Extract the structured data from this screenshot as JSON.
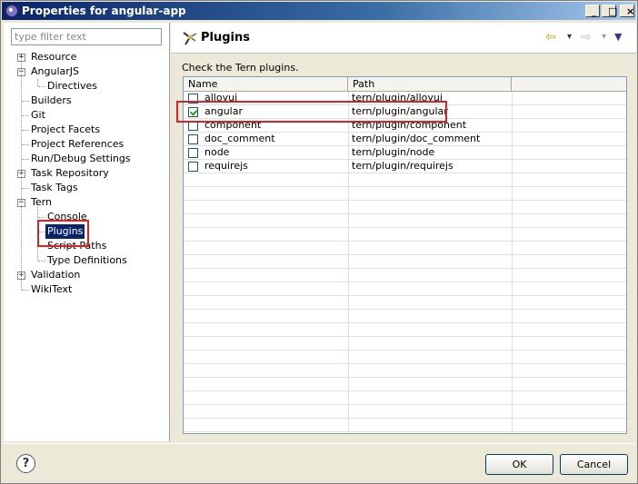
{
  "window": {
    "title": "Properties for angular-app"
  },
  "title_buttons": {
    "minimize": "_",
    "maximize": "□",
    "close": "×"
  },
  "filter": {
    "placeholder": "type filter text"
  },
  "tree": {
    "items": [
      {
        "label": "Resource",
        "level": 0,
        "expander": "+"
      },
      {
        "label": "AngularJS",
        "level": 0,
        "expander": "−"
      },
      {
        "label": "Directives",
        "level": 1
      },
      {
        "label": "Builders",
        "level": 0
      },
      {
        "label": "Git",
        "level": 0
      },
      {
        "label": "Project Facets",
        "level": 0
      },
      {
        "label": "Project References",
        "level": 0
      },
      {
        "label": "Run/Debug Settings",
        "level": 0
      },
      {
        "label": "Task Repository",
        "level": 0,
        "expander": "+"
      },
      {
        "label": "Task Tags",
        "level": 0
      },
      {
        "label": "Tern",
        "level": 0,
        "expander": "−"
      },
      {
        "label": "Console",
        "level": 1
      },
      {
        "label": "Plugins",
        "level": 1,
        "selected": true
      },
      {
        "label": "Script Paths",
        "level": 1
      },
      {
        "label": "Type Definitions",
        "level": 1
      },
      {
        "label": "Validation",
        "level": 0,
        "expander": "+"
      },
      {
        "label": "WikiText",
        "level": 0
      }
    ]
  },
  "page": {
    "title": "Plugins",
    "description": "Check the Tern plugins.",
    "nav": {
      "back": "⇦",
      "back_menu": "▾",
      "forward": "⇨",
      "forward_menu": "▾",
      "view_menu": "▼"
    }
  },
  "table": {
    "columns": [
      "Name",
      "Path"
    ],
    "rows": [
      {
        "name": "alloyui",
        "path": "tern/plugin/alloyui",
        "checked": false
      },
      {
        "name": "angular",
        "path": "tern/plugin/angular",
        "checked": true
      },
      {
        "name": "component",
        "path": "tern/plugin/component",
        "checked": false
      },
      {
        "name": "doc_comment",
        "path": "tern/plugin/doc_comment",
        "checked": false
      },
      {
        "name": "node",
        "path": "tern/plugin/node",
        "checked": false
      },
      {
        "name": "requirejs",
        "path": "tern/plugin/requirejs",
        "checked": false
      }
    ]
  },
  "buttons": {
    "help": "?",
    "ok": "OK",
    "cancel": "Cancel"
  },
  "colors": {
    "selection": "#0a246a",
    "annotation": "#dd2222",
    "check": "#21a121"
  }
}
